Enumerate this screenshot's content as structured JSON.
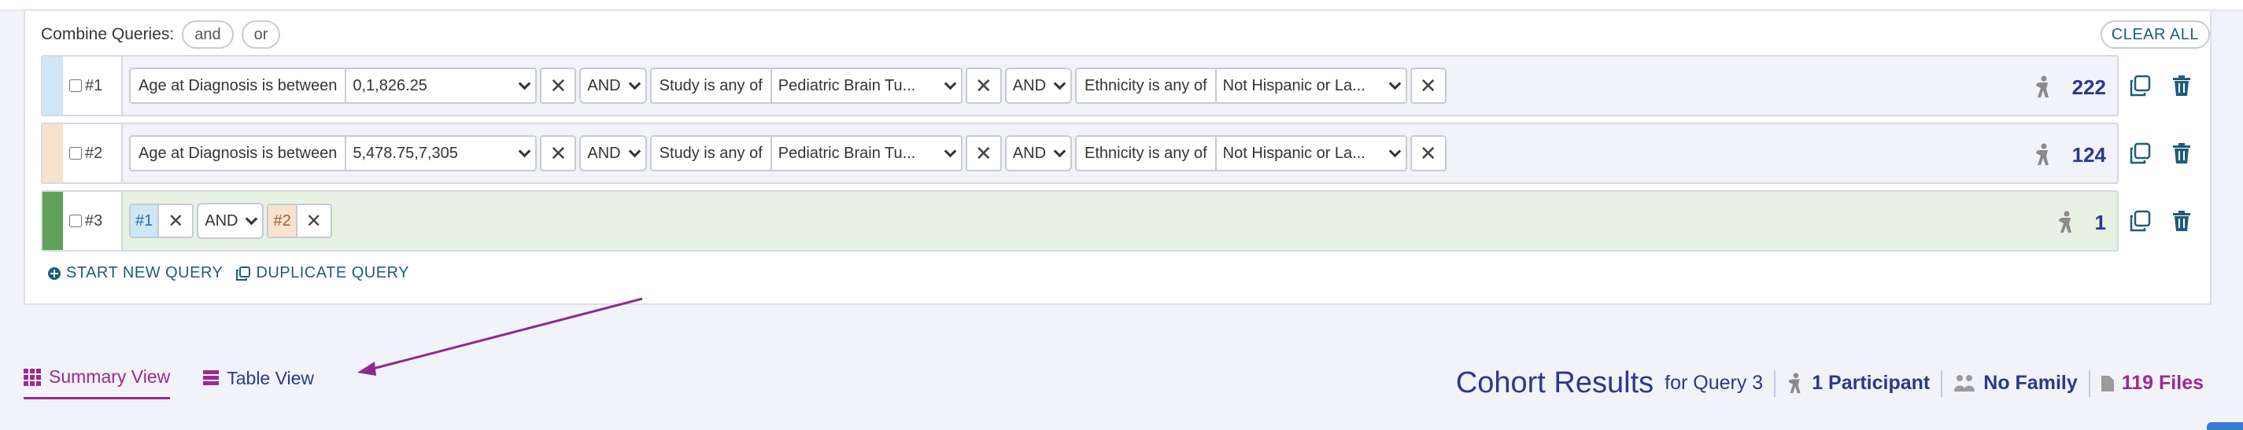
{
  "combine": {
    "label": "Combine Queries:",
    "and": "and",
    "or": "or",
    "clear_all": "CLEAR ALL"
  },
  "queries": [
    {
      "id": "#1",
      "color": "#cfe6f5",
      "count": "222",
      "filters": [
        {
          "label": "Age at Diagnosis is between",
          "value": "0,1,826.25"
        },
        {
          "op": "AND",
          "label": "Study is any of",
          "value": "Pediatric Brain Tu..."
        },
        {
          "op": "AND",
          "label": "Ethnicity is any of",
          "value": "Not Hispanic or La..."
        }
      ]
    },
    {
      "id": "#2",
      "color": "#f9e3cf",
      "count": "124",
      "filters": [
        {
          "label": "Age at Diagnosis is between",
          "value": "5,478.75,7,305"
        },
        {
          "op": "AND",
          "label": "Study is any of",
          "value": "Pediatric Brain Tu..."
        },
        {
          "op": "AND",
          "label": "Ethnicity is any of",
          "value": "Not Hispanic or La..."
        }
      ]
    },
    {
      "id": "#3",
      "color": "#5fa35a",
      "count": "1",
      "refs": [
        {
          "tag": "#1",
          "color": "#cfe6f5"
        },
        {
          "op": "AND"
        },
        {
          "tag": "#2",
          "color": "#f9e3cf"
        }
      ]
    }
  ],
  "links": {
    "new_query": "START NEW QUERY",
    "duplicate": "DUPLICATE QUERY"
  },
  "tabs": {
    "summary": "Summary View",
    "table": "Table View"
  },
  "results": {
    "title": "Cohort Results",
    "sub": "for Query 3",
    "participants": "1 Participant",
    "family": "No Family",
    "files": "119 Files"
  },
  "colors": {
    "accent": "#9c2a8e",
    "primary": "#2b388f",
    "link": "#1f5d7a"
  }
}
